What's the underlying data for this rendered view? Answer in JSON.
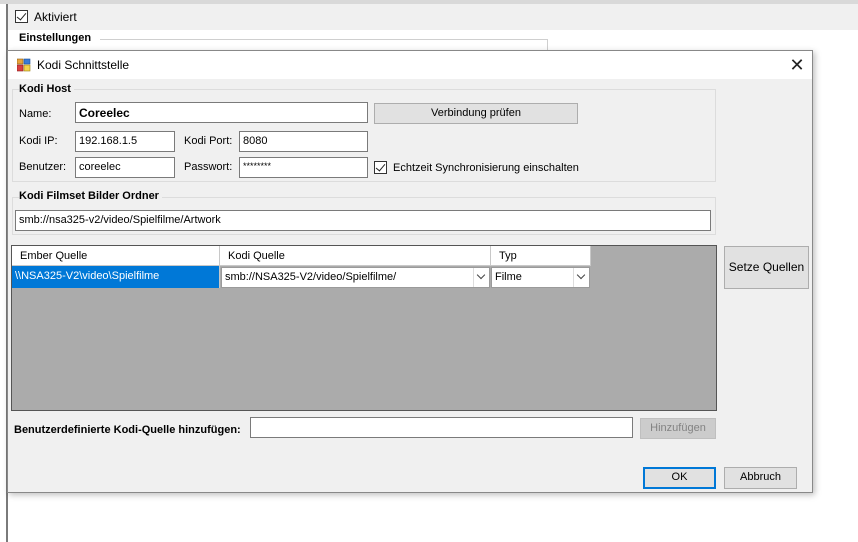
{
  "background": {
    "checkbox_label": "Aktiviert",
    "checkbox_checked": true,
    "group_title": "Einstellungen"
  },
  "dialog": {
    "title": "Kodi Schnittstelle",
    "close_glyph": "✕",
    "host_group": {
      "title": "Kodi Host",
      "name_label": "Name:",
      "name_value": "Coreelec",
      "verify_button": "Verbindung prüfen",
      "ip_label": "Kodi IP:",
      "ip_value": "192.168.1.5",
      "port_label": "Kodi Port:",
      "port_value": "8080",
      "user_label": "Benutzer:",
      "user_value": "coreelec",
      "password_label": "Passwort:",
      "password_value": "********",
      "realtime_label": "Echtzeit Synchronisierung einschalten",
      "realtime_checked": true
    },
    "artwork_group": {
      "title": "Kodi Filmset Bilder Ordner",
      "path_value": "smb://nsa325-v2/video/Spielfilme/Artwork"
    },
    "sources_grid": {
      "columns": [
        "Ember Quelle",
        "Kodi Quelle",
        "Typ"
      ],
      "rows": [
        {
          "ember": "\\\\NSA325-V2\\video\\Spielfilme",
          "kodi": "smb://NSA325-V2/video/Spielfilme/",
          "type": "Filme"
        }
      ]
    },
    "set_sources_button": "Setze Quellen",
    "custom_source_label": "Benutzerdefinierte Kodi-Quelle hinzufügen:",
    "custom_source_value": "",
    "add_button": "Hinzufügen",
    "ok_button": "OK",
    "cancel_button": "Abbruch"
  },
  "icons": {
    "title_icon": "kodi-app-icon",
    "close": "close-icon",
    "dropdown": "chevron-down-icon"
  },
  "colors": {
    "selection": "#0078d7",
    "grid_background": "#ababab",
    "dialog_background": "#f0f0f0"
  }
}
